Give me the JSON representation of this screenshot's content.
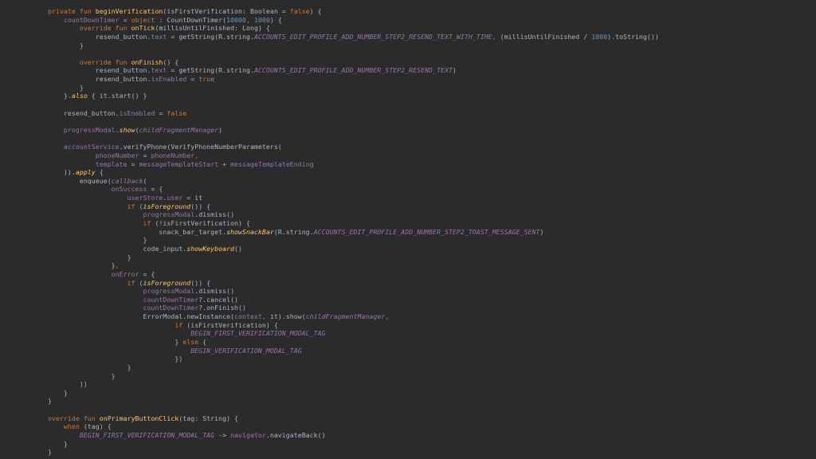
{
  "colors": {
    "background": "#2b2b2b",
    "keyword": "#cc7832",
    "function": "#ffc66d",
    "number": "#6897bb",
    "property": "#9876aa",
    "text": "#a9b7c6"
  },
  "code_lines": [
    [
      [
        "kw",
        "private fun "
      ],
      [
        "fn",
        "beginVerification"
      ],
      [
        "plain",
        "(isFirstVerification: Boolean = "
      ],
      [
        "kw",
        "false"
      ],
      [
        "plain",
        ") {"
      ]
    ],
    [
      [
        "plain",
        "    "
      ],
      [
        "prop",
        "countDownTimer"
      ],
      [
        "plain",
        " = "
      ],
      [
        "kw",
        "object"
      ],
      [
        "plain",
        " : CountDownTimer("
      ],
      [
        "num",
        "10000"
      ],
      [
        "kw",
        ", "
      ],
      [
        "num",
        "1000"
      ],
      [
        "plain",
        ") {"
      ]
    ],
    [
      [
        "plain",
        "        "
      ],
      [
        "kw",
        "override fun "
      ],
      [
        "fn",
        "onTick"
      ],
      [
        "plain",
        "(millisUntilFinished: Long) {"
      ]
    ],
    [
      [
        "plain",
        "            resend_button."
      ],
      [
        "prop",
        "text"
      ],
      [
        "plain",
        " = getString(R.string."
      ],
      [
        "stat",
        "ACCOUNTS_EDIT_PROFILE_ADD_NUMBER_STEP2_RESEND_TEXT_WITH_TIME"
      ],
      [
        "kw",
        ", "
      ],
      [
        "plain",
        "(millisUntilFinished / "
      ],
      [
        "num",
        "1000"
      ],
      [
        "plain",
        ").toString())"
      ]
    ],
    [
      [
        "plain",
        "        }"
      ]
    ],
    [
      [
        "plain",
        ""
      ]
    ],
    [
      [
        "plain",
        "        "
      ],
      [
        "kw",
        "override fun "
      ],
      [
        "fn",
        "onFinish"
      ],
      [
        "plain",
        "() {"
      ]
    ],
    [
      [
        "plain",
        "            resend_button."
      ],
      [
        "prop",
        "text"
      ],
      [
        "plain",
        " = getString(R.string."
      ],
      [
        "stat",
        "ACCOUNTS_EDIT_PROFILE_ADD_NUMBER_STEP2_RESEND_TEXT"
      ],
      [
        "plain",
        ")"
      ]
    ],
    [
      [
        "plain",
        "            resend_button."
      ],
      [
        "prop",
        "isEnabled"
      ],
      [
        "plain",
        " = "
      ],
      [
        "kw",
        "true"
      ]
    ],
    [
      [
        "plain",
        "        }"
      ]
    ],
    [
      [
        "plain",
        "    }."
      ],
      [
        "ext",
        "also"
      ],
      [
        "plain",
        " { it.start() }"
      ]
    ],
    [
      [
        "plain",
        ""
      ]
    ],
    [
      [
        "plain",
        "    resend_button."
      ],
      [
        "prop",
        "isEnabled"
      ],
      [
        "plain",
        " = "
      ],
      [
        "kw",
        "false"
      ]
    ],
    [
      [
        "plain",
        ""
      ]
    ],
    [
      [
        "plain",
        "    "
      ],
      [
        "prop",
        "progressModal"
      ],
      [
        "plain",
        "."
      ],
      [
        "ext",
        "show"
      ],
      [
        "plain",
        "("
      ],
      [
        "stat",
        "childFragmentManager"
      ],
      [
        "plain",
        ")"
      ]
    ],
    [
      [
        "plain",
        ""
      ]
    ],
    [
      [
        "plain",
        "    "
      ],
      [
        "prop",
        "accountService"
      ],
      [
        "plain",
        ".verifyPhone(VerifyPhoneNumberParameters("
      ]
    ],
    [
      [
        "plain",
        "            "
      ],
      [
        "prop",
        "phoneNumber"
      ],
      [
        "plain",
        " = "
      ],
      [
        "prop",
        "phoneNumber"
      ],
      [
        "kw",
        ","
      ]
    ],
    [
      [
        "plain",
        "            "
      ],
      [
        "prop",
        "template"
      ],
      [
        "plain",
        " = "
      ],
      [
        "prop",
        "messageTemplateStart"
      ],
      [
        "plain",
        " + "
      ],
      [
        "prop",
        "messageTemplateEnding"
      ]
    ],
    [
      [
        "plain",
        "    ))."
      ],
      [
        "ext",
        "apply"
      ],
      [
        "plain",
        " {"
      ]
    ],
    [
      [
        "plain",
        "        enqueue("
      ],
      [
        "stat",
        "callback"
      ],
      [
        "plain",
        "("
      ]
    ],
    [
      [
        "plain",
        "                "
      ],
      [
        "prop",
        "onSuccess"
      ],
      [
        "plain",
        " = {"
      ]
    ],
    [
      [
        "plain",
        "                    "
      ],
      [
        "prop",
        "userStore"
      ],
      [
        "plain",
        "."
      ],
      [
        "prop",
        "user"
      ],
      [
        "plain",
        " = it"
      ]
    ],
    [
      [
        "plain",
        "                    "
      ],
      [
        "kw",
        "if"
      ],
      [
        "plain",
        " ("
      ],
      [
        "ext",
        "isForeground"
      ],
      [
        "plain",
        "()) {"
      ]
    ],
    [
      [
        "plain",
        "                        "
      ],
      [
        "prop",
        "progressModal"
      ],
      [
        "plain",
        ".dismiss()"
      ]
    ],
    [
      [
        "plain",
        "                        "
      ],
      [
        "kw",
        "if"
      ],
      [
        "plain",
        " (!isFirstVerification) {"
      ]
    ],
    [
      [
        "plain",
        "                            snack_bar_target."
      ],
      [
        "ext",
        "showSnackBar"
      ],
      [
        "plain",
        "(R.string."
      ],
      [
        "stat",
        "ACCOUNTS_EDIT_PROFILE_ADD_NUMBER_STEP2_TOAST_MESSAGE_SENT"
      ],
      [
        "plain",
        ")"
      ]
    ],
    [
      [
        "plain",
        "                        }"
      ]
    ],
    [
      [
        "plain",
        "                        code_input."
      ],
      [
        "ext",
        "showKeyboard"
      ],
      [
        "plain",
        "()"
      ]
    ],
    [
      [
        "plain",
        "                    }"
      ]
    ],
    [
      [
        "plain",
        "                }"
      ],
      [
        "kw",
        ","
      ]
    ],
    [
      [
        "plain",
        "                "
      ],
      [
        "prop",
        "onError"
      ],
      [
        "plain",
        " = {"
      ]
    ],
    [
      [
        "plain",
        "                    "
      ],
      [
        "kw",
        "if"
      ],
      [
        "plain",
        " ("
      ],
      [
        "ext",
        "isForeground"
      ],
      [
        "plain",
        "()) {"
      ]
    ],
    [
      [
        "plain",
        "                        "
      ],
      [
        "prop",
        "progressModal"
      ],
      [
        "plain",
        ".dismiss()"
      ]
    ],
    [
      [
        "plain",
        "                        "
      ],
      [
        "prop",
        "countDownTimer"
      ],
      [
        "plain",
        "?.cancel()"
      ]
    ],
    [
      [
        "plain",
        "                        "
      ],
      [
        "prop",
        "countDownTimer"
      ],
      [
        "plain",
        "?.onFinish()"
      ]
    ],
    [
      [
        "plain",
        "                        ErrorModal.newInstance("
      ],
      [
        "prop",
        "context"
      ],
      [
        "kw",
        ", "
      ],
      [
        "plain",
        "it).show("
      ],
      [
        "stat",
        "childFragmentManager"
      ],
      [
        "kw",
        ","
      ]
    ],
    [
      [
        "plain",
        "                                "
      ],
      [
        "kw",
        "if"
      ],
      [
        "plain",
        " (isFirstVerification) {"
      ]
    ],
    [
      [
        "plain",
        "                                    "
      ],
      [
        "stat",
        "BEGIN_FIRST_VERIFICATION_MODAL_TAG"
      ]
    ],
    [
      [
        "plain",
        "                                } "
      ],
      [
        "kw",
        "else"
      ],
      [
        "plain",
        " {"
      ]
    ],
    [
      [
        "plain",
        "                                    "
      ],
      [
        "stat",
        "BEGIN_VERIFICATION_MODAL_TAG"
      ]
    ],
    [
      [
        "plain",
        "                                })"
      ]
    ],
    [
      [
        "plain",
        "                    }"
      ]
    ],
    [
      [
        "plain",
        "                }"
      ]
    ],
    [
      [
        "plain",
        "        ))"
      ]
    ],
    [
      [
        "plain",
        "    }"
      ]
    ],
    [
      [
        "plain",
        "}"
      ]
    ],
    [
      [
        "plain",
        ""
      ]
    ],
    [
      [
        "kw",
        "override fun "
      ],
      [
        "fn",
        "onPrimaryButtonClick"
      ],
      [
        "plain",
        "(tag: String) {"
      ]
    ],
    [
      [
        "plain",
        "    "
      ],
      [
        "kw",
        "when"
      ],
      [
        "plain",
        " (tag) {"
      ]
    ],
    [
      [
        "plain",
        "        "
      ],
      [
        "stat",
        "BEGIN_FIRST_VERIFICATION_MODAL_TAG"
      ],
      [
        "plain",
        " -> "
      ],
      [
        "prop",
        "navigator"
      ],
      [
        "plain",
        ".navigateBack()"
      ]
    ],
    [
      [
        "plain",
        "    }"
      ]
    ],
    [
      [
        "plain",
        "}"
      ]
    ]
  ]
}
